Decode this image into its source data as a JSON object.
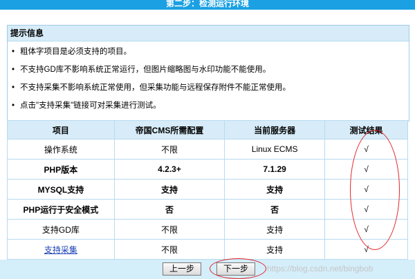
{
  "window": {
    "title": "第二步：检测运行环境"
  },
  "tips": {
    "heading": "提示信息",
    "items": [
      "粗体字项目是必须支持的项目。",
      "不支持GD库不影响系统正常运行，但图片缩略图与水印功能不能使用。",
      "不支持采集不影响系统正常使用，但采集功能与远程保存附件不能正常使用。",
      "点击\"支持采集\"链接可对采集进行测试。"
    ]
  },
  "table": {
    "headers": [
      "项目",
      "帝国CMS所需配置",
      "当前服务器",
      "测试结果"
    ],
    "rows": [
      {
        "item": "操作系统",
        "required": "不限",
        "current": "Linux ECMS",
        "result": "√"
      },
      {
        "item": "PHP版本",
        "required": "4.2.3+",
        "current": "7.1.29",
        "result": "√"
      },
      {
        "item": "MYSQL支持",
        "required": "支持",
        "current": "支持",
        "result": "√"
      },
      {
        "item": "PHP运行于安全模式",
        "required": "否",
        "current": "否",
        "result": "√"
      },
      {
        "item": "支持GD库",
        "required": "不限",
        "current": "支持",
        "result": "√"
      },
      {
        "item": "支持采集",
        "required": "不限",
        "current": "支持",
        "result": "√"
      }
    ]
  },
  "buttons": {
    "prev": "上一步",
    "next": "下一步"
  },
  "watermark": "https://blog.csdn.net/bingbob"
}
